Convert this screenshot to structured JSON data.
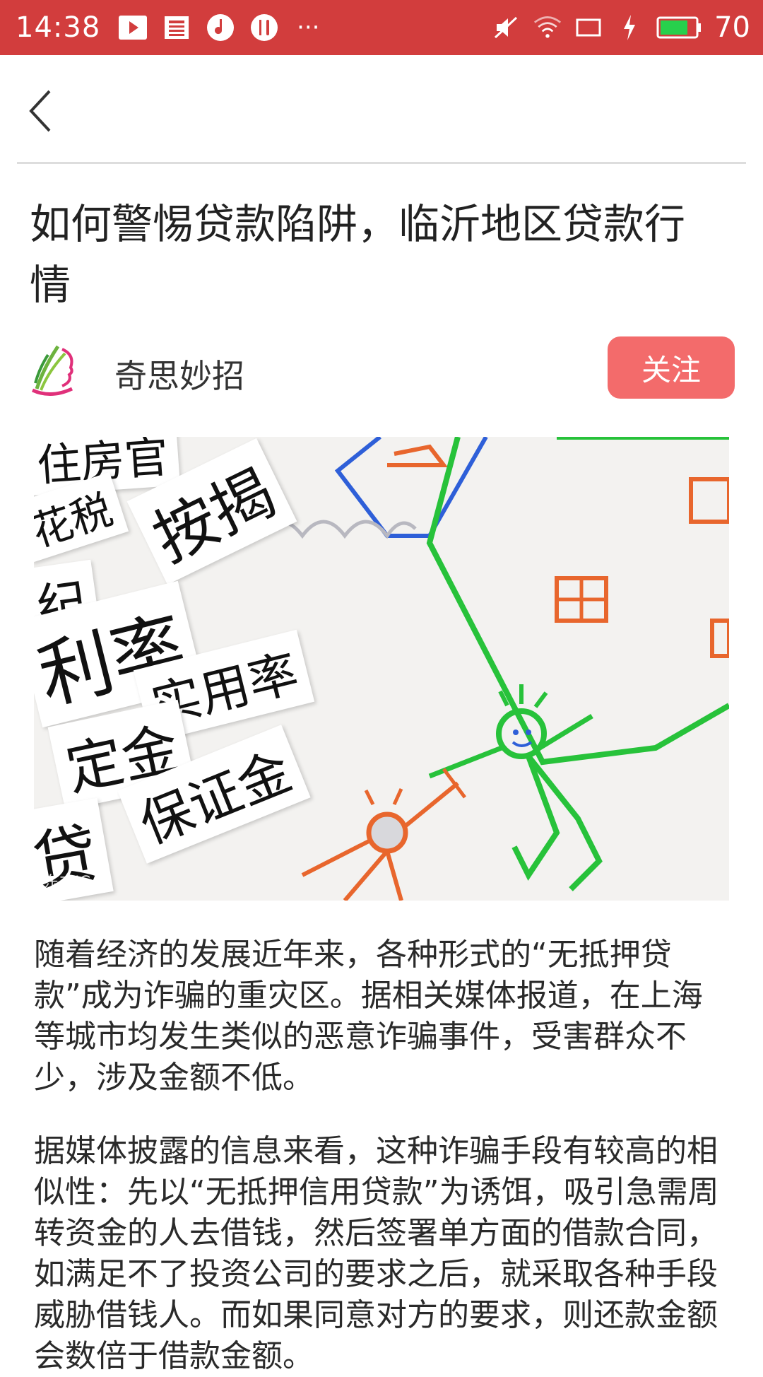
{
  "status_bar": {
    "time": "14:38",
    "more": "···",
    "battery": "70",
    "bg_color": "#d23d3d"
  },
  "app_bar": {
    "back_icon": "chevron-left-icon"
  },
  "article": {
    "title": "如何警惕贷款陷阱，临沂地区贷款行情",
    "author": "奇思妙招",
    "follow_label": "关注",
    "image_words": [
      "住房官",
      "花税",
      "按揭",
      "纪",
      "利率",
      "实用率",
      "定金",
      "保证金",
      "贷"
    ],
    "watermark": "东方IC",
    "paragraphs": [
      "随着经济的发展近年来，各种形式的“无抵押贷款”成为诈骗的重灾区。据相关媒体报道，在上海等城市均发生类似的恶意诈骗事件，受害群众不少，涉及金额不低。",
      "据媒体披露的信息来看，这种诈骗手段有较高的相似性：先以“无抵押信用贷款”为诱饵，吸引急需周转资金的人去借钱，然后签署单方面的借款合同，如满足不了投资公司的要求之后，就采取各种手段威胁借钱人。而如果同意对方的要求，则还款金额会数倍于借款金额。"
    ],
    "accent_color": "#f36b6b"
  }
}
